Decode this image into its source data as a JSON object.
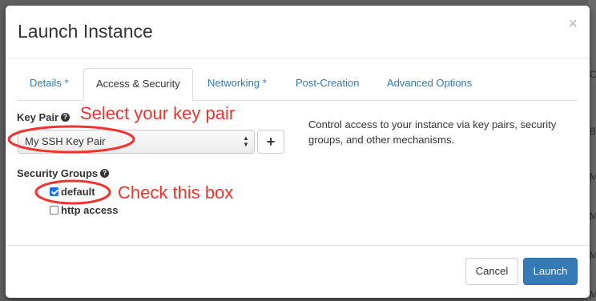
{
  "modal": {
    "title": "Launch Instance",
    "close_glyph": "×"
  },
  "tabs": [
    {
      "label": "Details *",
      "active": false
    },
    {
      "label": "Access & Security",
      "active": true
    },
    {
      "label": "Networking *",
      "active": false
    },
    {
      "label": "Post-Creation",
      "active": false
    },
    {
      "label": "Advanced Options",
      "active": false
    }
  ],
  "key_pair": {
    "label": "Key Pair",
    "selected": "My SSH Key Pair",
    "add_glyph": "+"
  },
  "help_text": "Control access to your instance via key pairs, security groups, and other mechanisms.",
  "security_groups": {
    "label": "Security Groups",
    "options": [
      {
        "label": "default",
        "checked": true
      },
      {
        "label": "http access",
        "checked": false
      }
    ]
  },
  "annotations": {
    "key_pair_note": "Select your key pair",
    "checkbox_note": "Check this box",
    "color": "#f0332e"
  },
  "footer": {
    "cancel_label": "Cancel",
    "launch_label": "Launch"
  },
  "background_chars": [
    "C",
    "B",
    "MB",
    "MB",
    "MB",
    "MB"
  ],
  "colors": {
    "link": "#337ab7",
    "primary": "#337ab7",
    "overlay": "#5f5f5f"
  },
  "icons": {
    "help": "question-circle-icon",
    "close": "close-icon",
    "add": "plus-icon",
    "select": "chevron-updown-icon"
  }
}
